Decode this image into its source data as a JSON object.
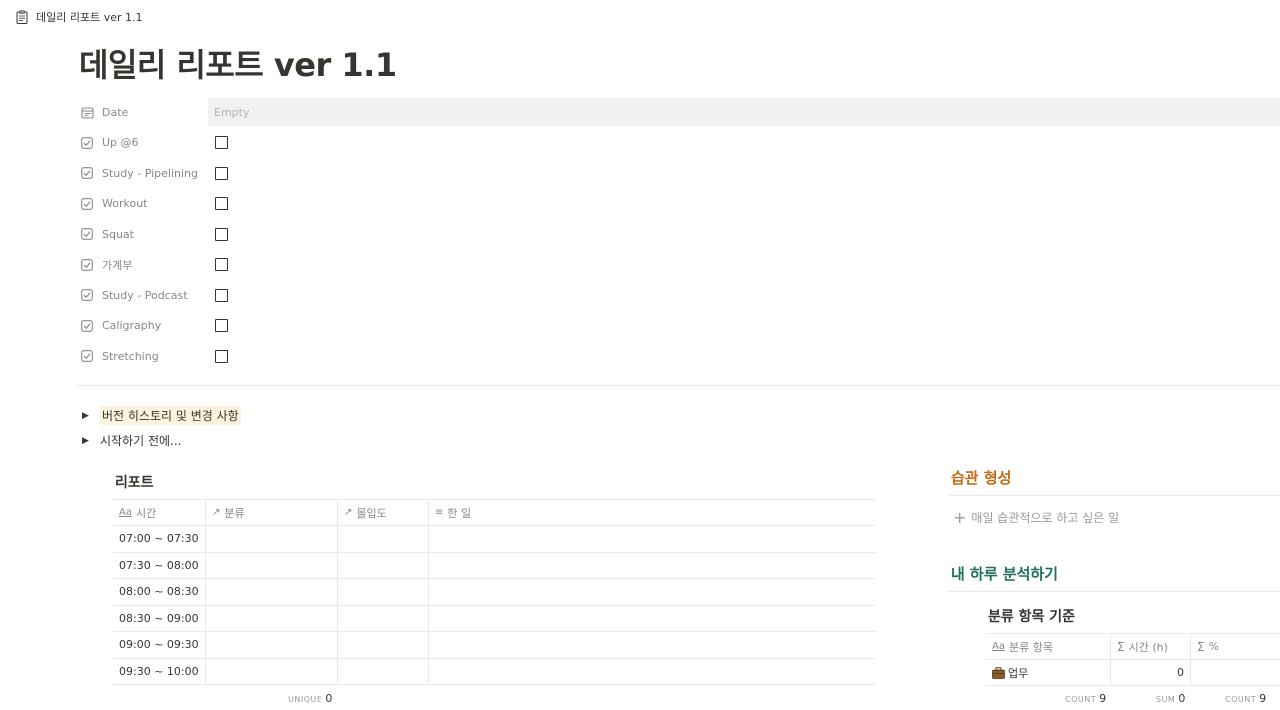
{
  "breadcrumb": {
    "icon": "clipboard-icon",
    "label": "데일리 리포트 ver 1.1"
  },
  "page": {
    "title": "데일리 리포트 ver 1.1"
  },
  "properties": {
    "date": {
      "label": "Date",
      "icon": "calendar-icon",
      "placeholder": "Empty"
    },
    "checkboxes": [
      {
        "label": "Up @6",
        "checked": false
      },
      {
        "label": "Study - Pipelining",
        "checked": false
      },
      {
        "label": "Workout",
        "checked": false
      },
      {
        "label": "Squat",
        "checked": false
      },
      {
        "label": "가계부",
        "checked": false
      },
      {
        "label": "Study - Podcast",
        "checked": false
      },
      {
        "label": "Caligraphy",
        "checked": false
      },
      {
        "label": "Stretching",
        "checked": false
      }
    ]
  },
  "toggles": [
    {
      "label": "버전 히스토리 및 변경 사항",
      "highlighted": true
    },
    {
      "label": "시작하기 전에..."
    }
  ],
  "report": {
    "title": "리포트",
    "columns": [
      "시간",
      "분류",
      "몰입도",
      "한 일"
    ],
    "column_icons": [
      "aa-icon",
      "relation-arrow-icon",
      "relation-arrow-icon",
      "text-lines-icon"
    ],
    "rows": [
      {
        "time": "07:00 ~ 07:30",
        "category": "",
        "focus": "",
        "done": ""
      },
      {
        "time": "07:30 ~ 08:00",
        "category": "",
        "focus": "",
        "done": ""
      },
      {
        "time": "08:00 ~ 08:30",
        "category": "",
        "focus": "",
        "done": ""
      },
      {
        "time": "08:30 ~ 09:00",
        "category": "",
        "focus": "",
        "done": ""
      },
      {
        "time": "09:00 ~ 09:30",
        "category": "",
        "focus": "",
        "done": ""
      },
      {
        "time": "09:30 ~ 10:00",
        "category": "",
        "focus": "",
        "done": ""
      }
    ],
    "aggregate": {
      "label": "UNIQUE",
      "value": "0"
    }
  },
  "habit": {
    "heading": "습관 형성",
    "heading_color": "#c26a15",
    "add_label": "매일 습관적으로 하고 싶은 일"
  },
  "analysis": {
    "heading": "내 하루 분석하기",
    "heading_color": "#1f6f5c",
    "table_title": "분류 항목 기준",
    "columns": [
      "분류 항목",
      "시간 (h)",
      "%"
    ],
    "column_icons": [
      "aa-icon",
      "sigma-icon",
      "sigma-icon"
    ],
    "rows": [
      {
        "icon": "briefcase-icon",
        "name": "업무",
        "hours": "0",
        "percent": ""
      }
    ],
    "aggregates": [
      {
        "label": "COUNT",
        "value": "9"
      },
      {
        "label": "SUM",
        "value": "0"
      },
      {
        "label": "COUNT",
        "value": "9"
      }
    ]
  }
}
